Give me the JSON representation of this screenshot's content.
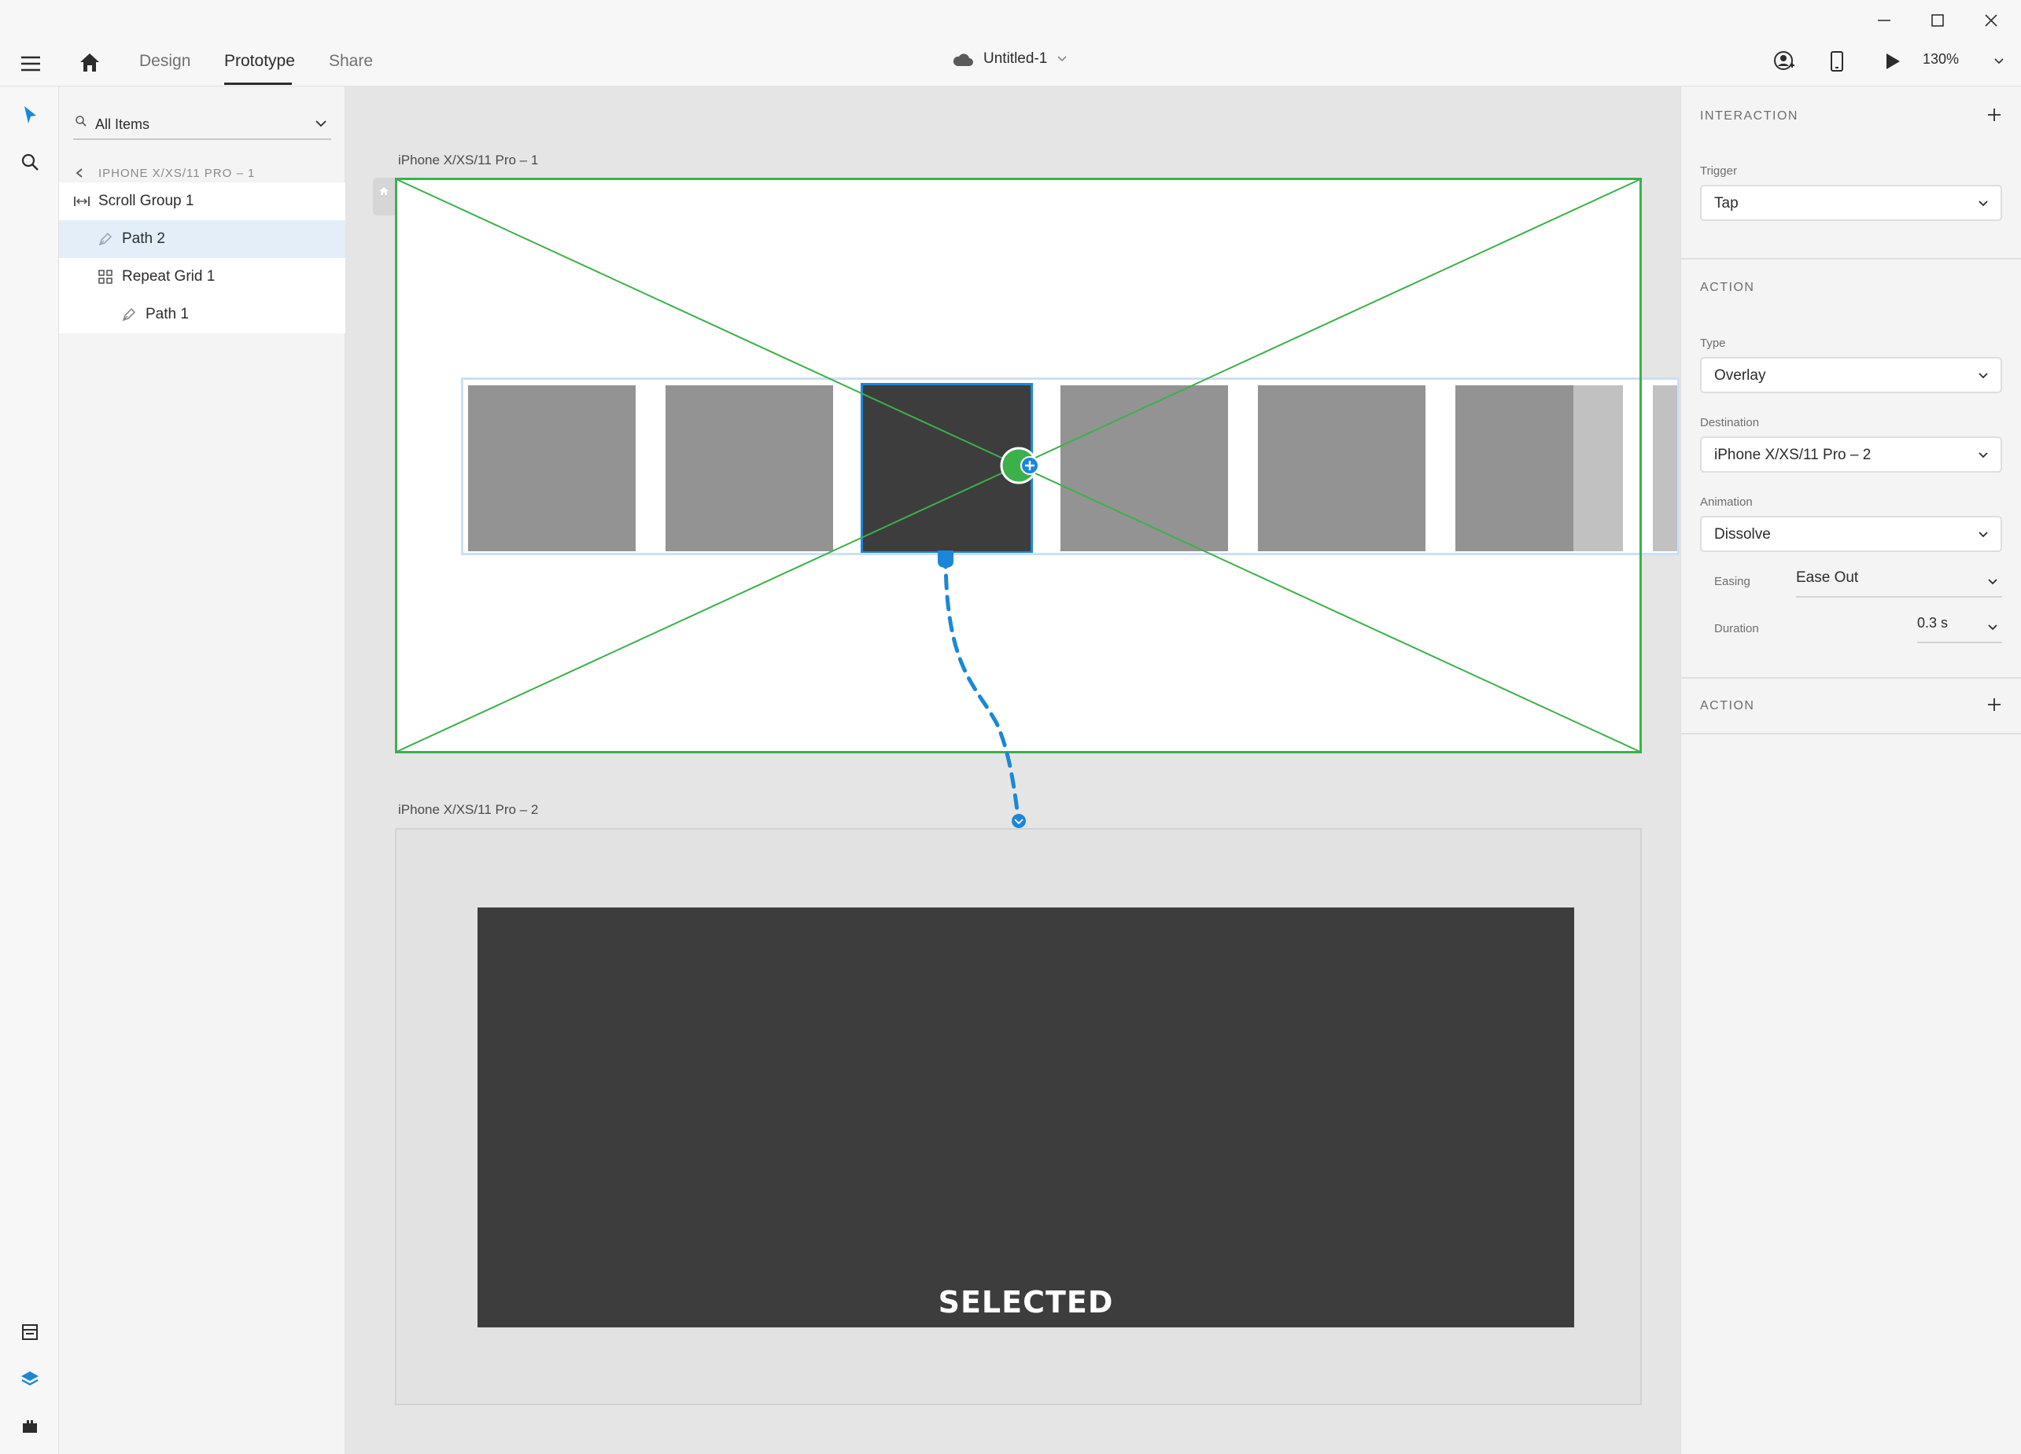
{
  "window": {
    "controls": [
      "minimize-icon",
      "maximize-icon",
      "close-icon"
    ]
  },
  "header": {
    "tabs": [
      {
        "label": "Design",
        "active": false
      },
      {
        "label": "Prototype",
        "active": true
      },
      {
        "label": "Share",
        "active": false
      }
    ],
    "document_title": "Untitled-1",
    "zoom": "130%"
  },
  "layers": {
    "search_placeholder": "All Items",
    "breadcrumb": "IPHONE X/XS/11 PRO – 1",
    "items": [
      {
        "label": "Scroll Group 1",
        "icon": "scroll-group-icon",
        "depth": 0,
        "selected": false
      },
      {
        "label": "Path 2",
        "icon": "pen-path-icon",
        "depth": 1,
        "selected": true
      },
      {
        "label": "Repeat Grid 1",
        "icon": "repeat-grid-icon",
        "depth": 1,
        "selected": false
      },
      {
        "label": "Path 1",
        "icon": "pen-path-icon",
        "depth": 2,
        "selected": false
      }
    ]
  },
  "canvas": {
    "artboard_1": {
      "label": "iPhone X/XS/11 Pro – 1"
    },
    "artboard_2": {
      "label": "iPhone X/XS/11 Pro – 2",
      "overlay_text": "SELECTED"
    }
  },
  "inspector": {
    "interaction": {
      "title": "INTERACTION",
      "trigger_label": "Trigger",
      "trigger_value": "Tap"
    },
    "action": {
      "title": "ACTION",
      "type_label": "Type",
      "type_value": "Overlay",
      "destination_label": "Destination",
      "destination_value": "iPhone X/XS/11 Pro – 2",
      "animation_label": "Animation",
      "animation_value": "Dissolve",
      "easing_label": "Easing",
      "easing_value": "Ease Out",
      "duration_label": "Duration",
      "duration_value": "0.3 s"
    },
    "action_2": {
      "title": "ACTION"
    }
  },
  "colors": {
    "accent_blue": "#1b87d9",
    "hotspot_green": "#3cb14a",
    "overlay_dark": "#3d3d3d"
  }
}
